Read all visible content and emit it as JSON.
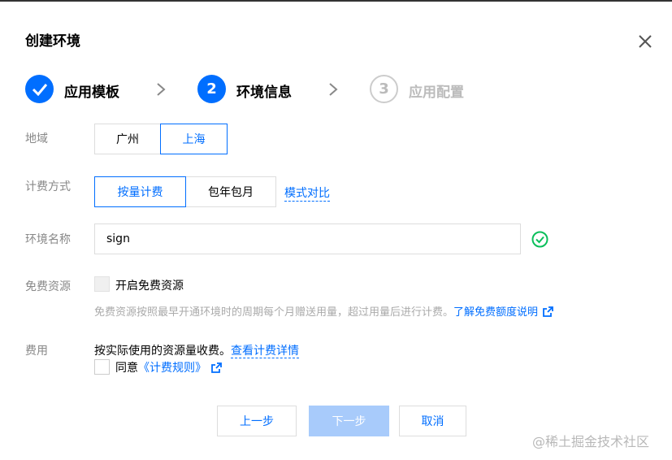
{
  "dialog": {
    "title": "创建环境",
    "close_icon": "close-icon"
  },
  "steps": [
    {
      "number": "1",
      "label": "应用模板",
      "status": "done",
      "icon": "check-icon"
    },
    {
      "number": "2",
      "label": "环境信息",
      "status": "active"
    },
    {
      "number": "3",
      "label": "应用配置",
      "status": "pending"
    }
  ],
  "region": {
    "label": "地域",
    "options": [
      "广州",
      "上海"
    ],
    "selected": "上海"
  },
  "billing": {
    "label": "计费方式",
    "options": [
      "按量计费",
      "包年包月"
    ],
    "selected": "按量计费",
    "compare_link": "模式对比"
  },
  "env_name": {
    "label": "环境名称",
    "value": "sign",
    "valid_icon": "check-circle-icon"
  },
  "free_resource": {
    "label": "免费资源",
    "checkbox_label": "开启免费资源",
    "hint": "免费资源按照最早开通环境时的周期每个月赠送用量，超过用量后进行计费。",
    "hint_link": "了解免费额度说明"
  },
  "fee": {
    "label": "费用",
    "text": "按实际使用的资源量收费。",
    "detail_link": "查看计费详情",
    "agree_label": "同意",
    "rules_link": "《计费规则》"
  },
  "footer": {
    "prev_label": "上一步",
    "next_label": "下一步",
    "cancel_label": "取消"
  },
  "watermark": "@稀土掘金技术社区",
  "colors": {
    "accent": "#006eff",
    "success": "#0abf5b",
    "disabled_primary": "#a8cbfb",
    "muted_text": "#888888"
  }
}
